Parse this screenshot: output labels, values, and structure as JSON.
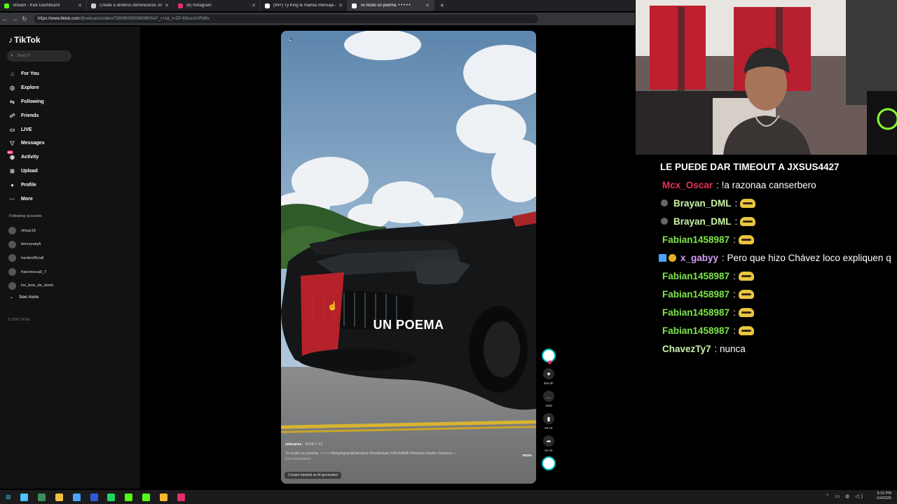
{
  "browser": {
    "tabs": [
      {
        "title": "Stream - Kick Dashboard",
        "color": "#53fc18",
        "active": false
      },
      {
        "title": "Create a dinleros dominicanos 20",
        "color": "#cccccc",
        "active": false
      },
      {
        "title": "(6) Instagram",
        "color": "#e1306c",
        "active": false
      },
      {
        "title": "(99+) Ty King le manda mensaje a",
        "color": "#ffffff",
        "active": false
      },
      {
        "title": "Te recito un poema. • • • • •",
        "color": "#ffffff",
        "active": true
      }
    ],
    "url_host": "https://www.tiktok.com",
    "url_path": "/@sekcarss/video/7390900500080980547_r=1&_t=ZP-92ksuXARbBv"
  },
  "tiktok": {
    "logo": "TikTok",
    "search_placeholder": "Search",
    "menu": [
      {
        "label": "For You",
        "icon": "home-icon",
        "glyph": "⌂"
      },
      {
        "label": "Explore",
        "icon": "compass-icon",
        "glyph": "◎"
      },
      {
        "label": "Following",
        "icon": "following-icon",
        "glyph": "⇆"
      },
      {
        "label": "Friends",
        "icon": "friends-icon",
        "glyph": "☍"
      },
      {
        "label": "LIVE",
        "icon": "live-icon",
        "glyph": "▭"
      },
      {
        "label": "Messages",
        "icon": "messages-icon",
        "glyph": "▽"
      },
      {
        "label": "Activity",
        "icon": "activity-icon",
        "glyph": "◉",
        "badge": "99+"
      },
      {
        "label": "Upload",
        "icon": "upload-icon",
        "glyph": "⊞"
      },
      {
        "label": "Profile",
        "icon": "profile-icon",
        "glyph": "●"
      },
      {
        "label": "More",
        "icon": "more-icon",
        "glyph": "···"
      }
    ],
    "following_title": "Following accounts",
    "following": [
      "nfinax18",
      "bennynaty6",
      "harden0ficiall",
      "franchesca0_7",
      "los_bots_de_domil"
    ],
    "see_more": "See more",
    "copyright": "© 2026 TikTok"
  },
  "video": {
    "overlay_text": "UN POEMA",
    "author": "sekcarss",
    "date": "· 2024-7-12",
    "caption": "Te recito un poema. • • • • •#jeep#grandcherokee #trackhawk #v8 #HEMI #historia #turbo #carrera --",
    "more": "more",
    "see_translation": "See translation",
    "ai_label": "Creator labeled as AI-generated",
    "likes": "666.8K",
    "comments": "1550",
    "saves": "68.2K",
    "shares": "56.4K"
  },
  "chat": [
    {
      "user": "",
      "text": "LE PUEDE DAR TIMEOUT A JXSUS4427",
      "color": "#ffffff",
      "emote": false,
      "badge": "none"
    },
    {
      "user": "Mcx_Oscar",
      "text": ": !a razonaa canserbero",
      "color": "#e8315a",
      "emote": false,
      "badge": "none"
    },
    {
      "user": "Brayan_DML",
      "text": ":",
      "color": "#c9f5a8",
      "emote": true,
      "badge": "dot"
    },
    {
      "user": "Brayan_DML",
      "text": ":",
      "color": "#c9f5a8",
      "emote": true,
      "badge": "dot"
    },
    {
      "user": "Fabian1458987",
      "text": ":",
      "color": "#7ee64a",
      "emote": true,
      "badge": "none"
    },
    {
      "user": "x_gabyy",
      "text": ": Pero que hizo Chávez loco expliquen q",
      "color": "#d49cf5",
      "emote": false,
      "badge": "mod"
    },
    {
      "user": "Fabian1458987",
      "text": ":",
      "color": "#7ee64a",
      "emote": true,
      "badge": "none"
    },
    {
      "user": "Fabian1458987",
      "text": ":",
      "color": "#7ee64a",
      "emote": true,
      "badge": "none"
    },
    {
      "user": "Fabian1458987",
      "text": ":",
      "color": "#7ee64a",
      "emote": true,
      "badge": "none"
    },
    {
      "user": "Fabian1458987",
      "text": ":",
      "color": "#7ee64a",
      "emote": true,
      "badge": "none"
    },
    {
      "user": "ChavezTy7",
      "text": ": nunca",
      "color": "#c9f5a8",
      "emote": false,
      "badge": "none"
    }
  ],
  "taskbar": {
    "time": "9:16 PM",
    "date": "1/4/2026",
    "apps": [
      "#4cc2ff",
      "#3a8f5a",
      "#f0c040",
      "#4aa3ff",
      "#2b5cd6",
      "#1ed760",
      "#53fc18",
      "#53fc18",
      "#f5b82e",
      "#e1306c"
    ]
  }
}
